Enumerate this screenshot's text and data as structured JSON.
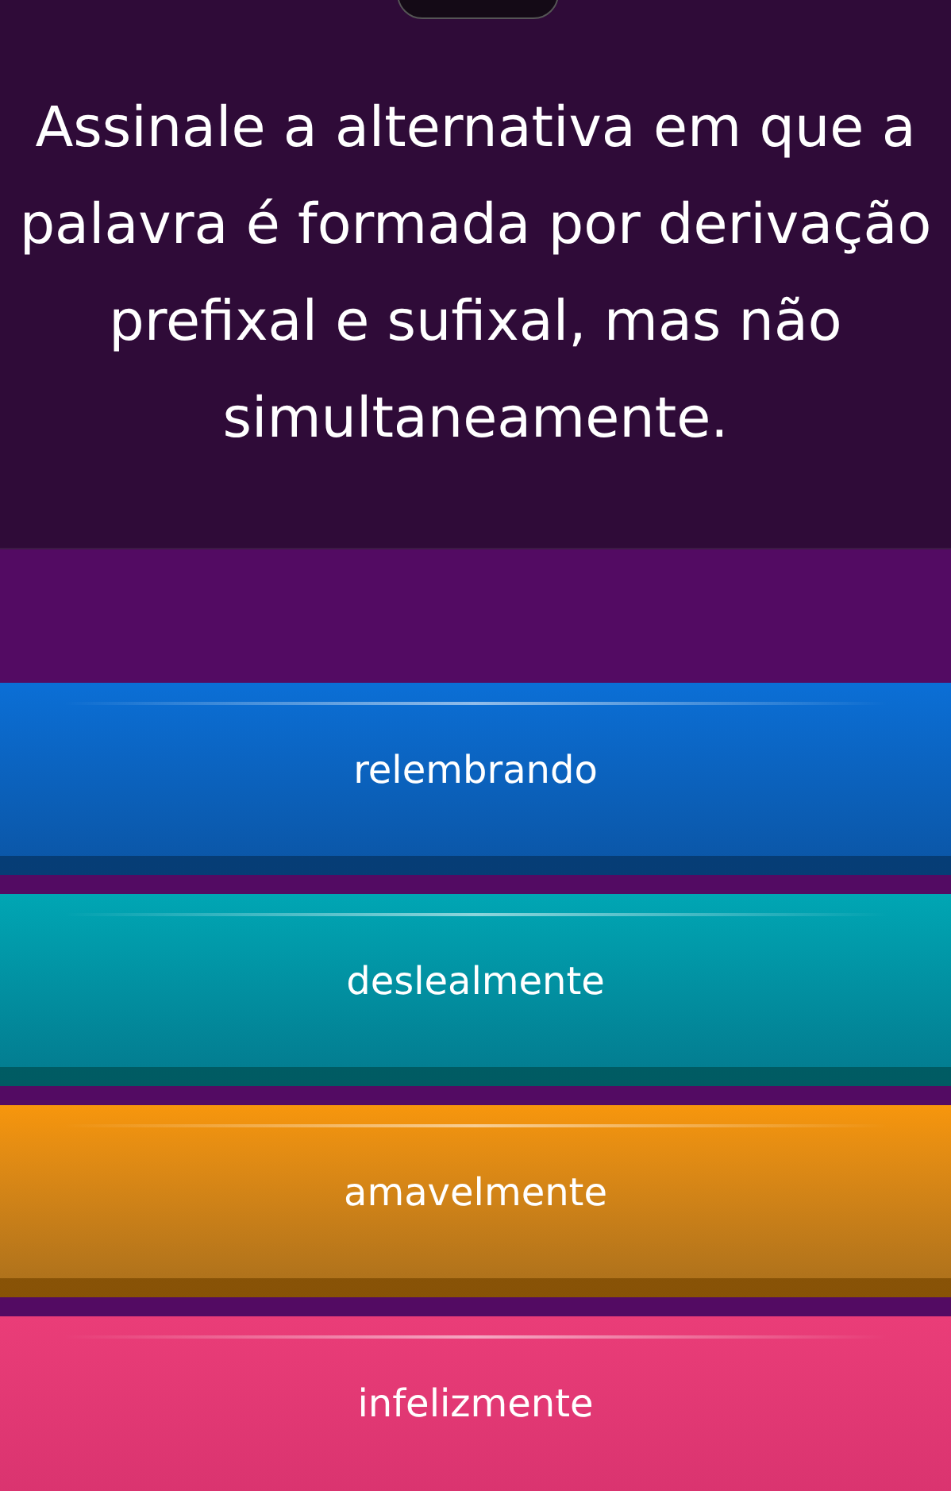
{
  "question": "Assinale a alternativa em que a palavra é formada por derivação prefixal e sufixal, mas não simultaneamente.",
  "options": [
    {
      "label": "relembrando",
      "color": "#0b6fd6"
    },
    {
      "label": "deslealmente",
      "color": "#00a6b4"
    },
    {
      "label": "amavelmente",
      "color": "#f7960c"
    },
    {
      "label": "infelizmente",
      "color": "#ea3d78"
    }
  ]
}
